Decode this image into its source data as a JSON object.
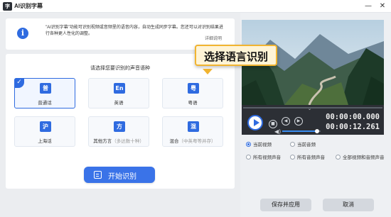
{
  "window": {
    "title": "AI识别字幕",
    "logo_text": "字",
    "minimize_glyph": "—",
    "close_glyph": "✕"
  },
  "info": {
    "icon_glyph": "i",
    "description": "\"AI识别字幕\"功能可识别视频或音频里的语音内容，自动生成同步字幕。您还可以对识别结果进行各种更人性化的调整。",
    "link_label": "详细说明"
  },
  "language_section": {
    "title": "请选择您要识别的声音语种",
    "options": [
      {
        "glyph": "普",
        "label": "普通话",
        "sub": "",
        "selected": true
      },
      {
        "glyph": "En",
        "label": "英语",
        "sub": "",
        "selected": false
      },
      {
        "glyph": "粤",
        "label": "粤语",
        "sub": "",
        "selected": false
      },
      {
        "glyph": "沪",
        "label": "上海话",
        "sub": "",
        "selected": false
      },
      {
        "glyph": "方",
        "label": "其他方言",
        "sub": "（多达数十种）",
        "selected": false
      },
      {
        "glyph": "混",
        "label": "混合",
        "sub": "（中英粤等并存）",
        "selected": false
      }
    ],
    "check_glyph": "✓"
  },
  "start_button": {
    "label": "开始识别"
  },
  "callout": {
    "text": "选择语言识别"
  },
  "player": {
    "current_time": "00:00:00.000",
    "total_time": "00:00:12.261",
    "volume_level": 0.9,
    "stop_glyph": "■",
    "prev_glyph": "◀",
    "next_glyph": "▶",
    "volume_glyph": "◀)",
    "marker_glyph": "⌄"
  },
  "scope_options": [
    {
      "label": "当前视频",
      "checked": true
    },
    {
      "label": "当前音频",
      "checked": false
    },
    {
      "label": "所有视频声音",
      "checked": false
    },
    {
      "label": "所有音频声音",
      "checked": false
    },
    {
      "label": "全部视频和音频声音",
      "checked": false
    }
  ],
  "footer": {
    "apply_label": "保存并应用",
    "cancel_label": "取消"
  },
  "colors": {
    "accent": "#2f6be0",
    "callout_border": "#f1b430",
    "callout_fill": "#fff4d6",
    "player_bg": "#2c2f35"
  }
}
